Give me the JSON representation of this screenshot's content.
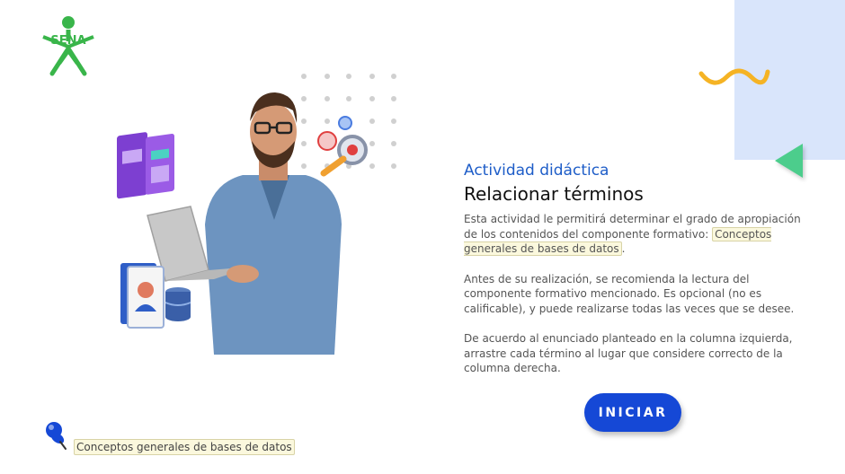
{
  "logo": {
    "text": "SENA",
    "color": "#39b54a"
  },
  "hero": {
    "icon": "person-with-laptop-illustration"
  },
  "content": {
    "activity_label": "Actividad didáctica",
    "title": "Relacionar términos",
    "p1_text": "Esta actividad le permitirá determinar el grado de apropiación de los contenidos del componente formativo: ",
    "p1_highlight": "Conceptos generales de bases de datos",
    "p1_end": ".",
    "p2": "Antes de su realización, se recomienda la lectura del componente formativo mencionado.  Es opcional (no es calificable), y puede realizarse todas las veces que se desee.",
    "p3": "De acuerdo al enunciado planteado en la columna izquierda, arrastre cada término al lugar que considere correcto de la columna derecha."
  },
  "start_button": {
    "label": "INICIAR",
    "color": "#1548d6"
  },
  "footer": {
    "label": "Conceptos generales de bases de datos",
    "icon": "pushpin-icon"
  },
  "colors": {
    "accent_blue": "#1e5dc8",
    "deco_green": "#4ccd8c",
    "deco_yellow": "#f5b324",
    "deco_light_blue": "#d9e5fb"
  }
}
